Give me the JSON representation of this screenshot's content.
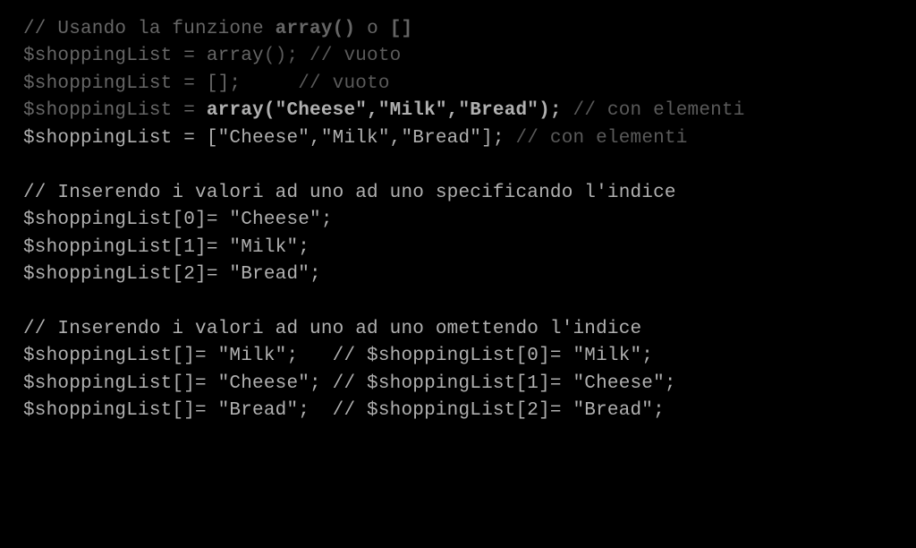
{
  "lines": [
    {
      "segs": [
        {
          "t": "// Usando la funzione ",
          "cls": ""
        },
        {
          "t": "array()",
          "cls": "bold"
        },
        {
          "t": " o ",
          "cls": ""
        },
        {
          "t": "[]",
          "cls": "bold"
        }
      ]
    },
    {
      "segs": [
        {
          "t": "$shoppingList = array",
          "cls": ""
        },
        {
          "t": "(); // vuoto",
          "cls": "comment"
        }
      ]
    },
    {
      "segs": [
        {
          "t": "$shoppingList = [];     ",
          "cls": ""
        },
        {
          "t": "// vuoto",
          "cls": "comment"
        }
      ]
    },
    {
      "segs": [
        {
          "t": "$shoppingList = ",
          "cls": ""
        },
        {
          "t": "array(\"Cheese\",\"Milk\",\"Bread\");",
          "cls": "bold hl"
        },
        {
          "t": " // con elementi",
          "cls": "comment"
        }
      ]
    },
    {
      "segs": [
        {
          "t": "$shoppingList = [\"Cheese\",\"Milk\",\"Bread\"]; ",
          "cls": "hl"
        },
        {
          "t": "// con elementi",
          "cls": "comment"
        }
      ]
    },
    {
      "segs": [
        {
          "t": "",
          "cls": ""
        }
      ]
    },
    {
      "segs": [
        {
          "t": "// Inserendo i valori ad uno ad uno specificando l'indice",
          "cls": "hl"
        }
      ]
    },
    {
      "segs": [
        {
          "t": "$shoppingList[0]= \"Cheese\";",
          "cls": "hl"
        }
      ]
    },
    {
      "segs": [
        {
          "t": "$shoppingList[1]= \"Milk\";",
          "cls": "hl"
        }
      ]
    },
    {
      "segs": [
        {
          "t": "$shoppingList[2]= \"Bread\";",
          "cls": "hl"
        }
      ]
    },
    {
      "segs": [
        {
          "t": "",
          "cls": ""
        }
      ]
    },
    {
      "segs": [
        {
          "t": "// Inserendo i valori ad uno ad uno omettendo l'indice",
          "cls": "hl"
        }
      ]
    },
    {
      "segs": [
        {
          "t": "$shoppingList[]= \"Milk\";   // $shoppingList[0]= \"Milk\";",
          "cls": "hl"
        }
      ]
    },
    {
      "segs": [
        {
          "t": "$shoppingList[]= \"Cheese\"; // $shoppingList[1]= \"Cheese\";",
          "cls": "hl"
        }
      ]
    },
    {
      "segs": [
        {
          "t": "$shoppingList[]= \"Bread\";  // $shoppingList[2]= \"Bread\";",
          "cls": "hl"
        }
      ]
    }
  ]
}
